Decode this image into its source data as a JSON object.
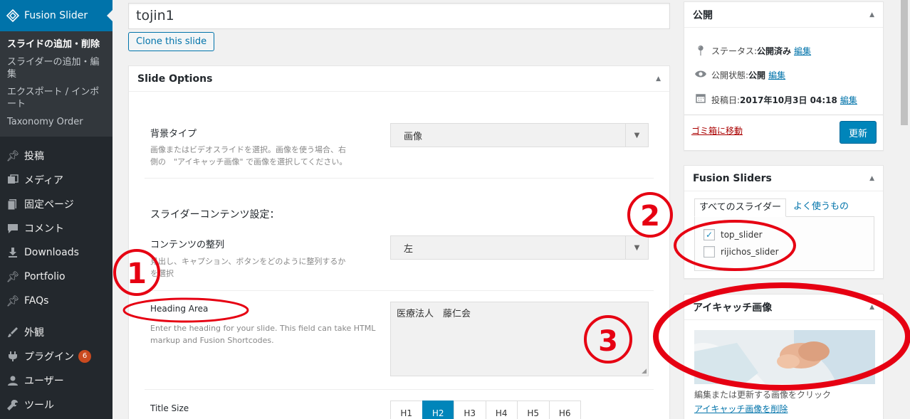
{
  "sidebar": {
    "current": "Fusion Slider",
    "submenu": [
      "スライドの追加・削除",
      "スライダーの追加・編集",
      "エクスポート / インポート",
      "Taxonomy Order"
    ],
    "items": [
      {
        "label": "投稿",
        "icon": "pin-icon"
      },
      {
        "label": "メディア",
        "icon": "media-icon"
      },
      {
        "label": "固定ページ",
        "icon": "pages-icon"
      },
      {
        "label": "コメント",
        "icon": "comment-icon"
      },
      {
        "label": "Downloads",
        "icon": "download-icon"
      },
      {
        "label": "Portfolio",
        "icon": "pin-icon"
      },
      {
        "label": "FAQs",
        "icon": "pin-icon"
      },
      {
        "label": "外観",
        "icon": "appearance-icon"
      },
      {
        "label": "プラグイン",
        "icon": "plugin-icon",
        "badge": "6"
      },
      {
        "label": "ユーザー",
        "icon": "user-icon"
      },
      {
        "label": "ツール",
        "icon": "tools-icon"
      }
    ]
  },
  "editor": {
    "title_value": "tojin1",
    "clone_label": "Clone this slide"
  },
  "slide_options": {
    "title": "Slide Options",
    "bg_type_label": "背景タイプ",
    "bg_type_desc_1": "画像またはビデオスライドを選択。画像を使う場合、右",
    "bg_type_desc_2": "側の　\"アイキャッチ画像\" で画像を選択してください。",
    "bg_type_value": "画像",
    "content_settings_heading": "スライダーコンテンツ設定：",
    "align_label": "コンテンツの整列",
    "align_desc_1": "見出し、キャプション、ボタンをどのように整列するか",
    "align_desc_2": "を選択",
    "align_value": "左",
    "heading_label": "Heading Area",
    "heading_desc_1": "Enter the heading for your slide. This field can take HTML",
    "heading_desc_2": "markup and Fusion Shortcodes.",
    "heading_value": "医療法人　藤仁会",
    "title_size_label": "Title Size",
    "title_sizes": [
      "H1",
      "H2",
      "H3",
      "H4",
      "H5",
      "H6"
    ],
    "title_size_selected": "H2"
  },
  "publish": {
    "title": "公開",
    "status_label": "ステータス: ",
    "status_value": "公開済み",
    "visibility_label": "公開状態: ",
    "visibility_value": "公開",
    "date_label": "投稿日: ",
    "date_value": "2017年10月3日 04:18",
    "edit_link": "編集",
    "trash_label": "ゴミ箱に移動",
    "update_label": "更新"
  },
  "sliders_box": {
    "title": "Fusion Sliders",
    "tab_all": "すべてのスライダー",
    "tab_popular": "よく使うもの",
    "options": [
      {
        "label": "top_slider",
        "checked": true
      },
      {
        "label": "rijichos_slider",
        "checked": false
      }
    ]
  },
  "featured_box": {
    "title": "アイキャッチ画像",
    "note": "編集または更新する画像をクリック",
    "remove_label": "アイキャッチ画像を削除"
  },
  "annotations": {
    "color": "#e60012",
    "labels": [
      "1",
      "2",
      "3"
    ]
  }
}
